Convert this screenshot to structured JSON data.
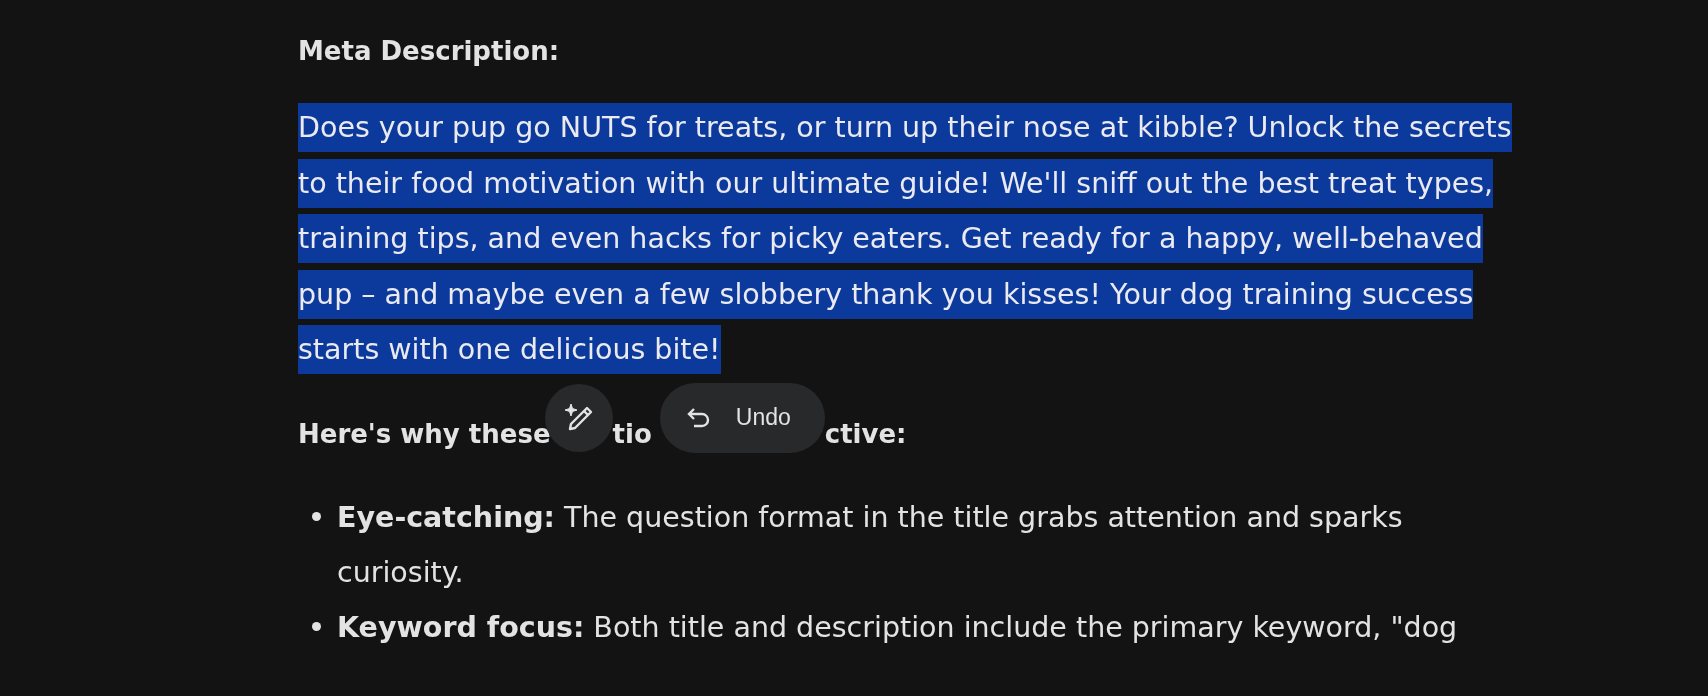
{
  "meta_heading": "Meta Description:",
  "meta_description": {
    "text": "Does your pup go NUTS for treats, or turn up their nose at kibble? Unlock the secrets to their food motivation with our ultimate guide! We'll sniff out the best treat types, training tips, and even hacks for picky eaters. Get ready for a happy, well-behaved pup – and maybe even a few slobbery thank you kisses! Your dog training success starts with one delicious bite!",
    "selected": true
  },
  "section_heading": {
    "visible_parts": [
      "Here's why these",
      "tio",
      "ctive:"
    ]
  },
  "floating_toolbar": {
    "undo_label": "Undo"
  },
  "bullets": [
    {
      "text": "**Eye-catching:** The question format in the title grabs attention and sparks curiosity."
    },
    {
      "text": "**Keyword focus:** Both title and description include the primary keyword, \"dog"
    }
  ]
}
